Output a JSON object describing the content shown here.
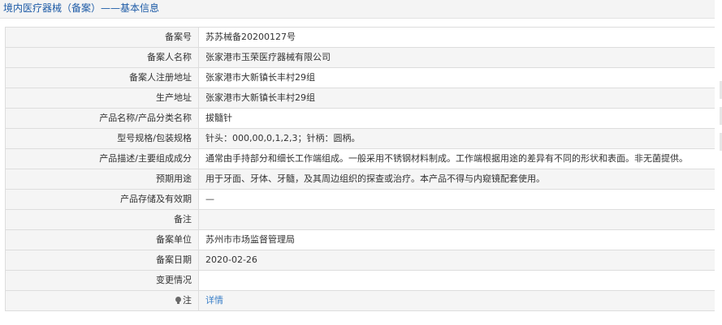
{
  "header": {
    "title": "境内医疗器械（备案）——基本信息"
  },
  "rows": [
    {
      "label": "备案号",
      "value": "苏苏械备20200127号"
    },
    {
      "label": "备案人名称",
      "value": "张家港市玉荣医疗器械有限公司"
    },
    {
      "label": "备案人注册地址",
      "value": "张家港市大新镇长丰村29组"
    },
    {
      "label": "生产地址",
      "value": "张家港市大新镇长丰村29组"
    },
    {
      "label": "产品名称/产品分类名称",
      "value": "拔髓针"
    },
    {
      "label": "型号规格/包装规格",
      "value": "针头：000,00,0,1,2,3；针柄：圆柄。"
    },
    {
      "label": "产品描述/主要组成成分",
      "value": "通常由手持部分和细长工作端组成。一般采用不锈钢材料制成。工作端根据用途的差异有不同的形状和表面。非无菌提供。"
    },
    {
      "label": "预期用途",
      "value": "用于牙面、牙体、牙髓，及其周边组织的探查或治疗。本产品不得与内窥镜配套使用。"
    },
    {
      "label": "产品存储及有效期",
      "value": "—"
    },
    {
      "label": "备注",
      "value": ""
    },
    {
      "label": "备案单位",
      "value": "苏州市市场监督管理局"
    },
    {
      "label": "备案日期",
      "value": "2020-02-26"
    },
    {
      "label": "变更情况",
      "value": ""
    },
    {
      "label": "注",
      "value": "详情",
      "icon": "lightbulb-icon"
    }
  ],
  "colors": {
    "title_text": "#1c5aa6",
    "link": "#3a7fc8",
    "border": "#dddddd",
    "alt_row": "#f5f5f5"
  }
}
